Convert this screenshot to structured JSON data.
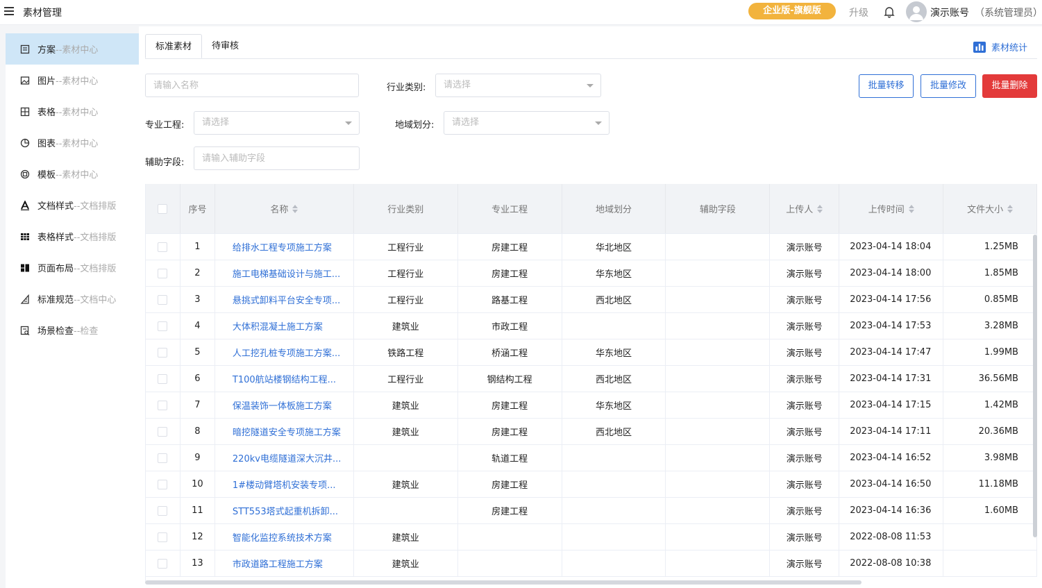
{
  "header": {
    "title": "素材管理",
    "plan_badge": "企业版-旗舰版",
    "upgrade": "升级",
    "user_name": "演示账号",
    "user_role": "（系统管理员）"
  },
  "sidebar": {
    "items": [
      {
        "label": "方案",
        "sub": "--素材中心",
        "icon": "document-icon"
      },
      {
        "label": "图片",
        "sub": "--素材中心",
        "icon": "image-icon"
      },
      {
        "label": "表格",
        "sub": "--素材中心",
        "icon": "table-icon"
      },
      {
        "label": "图表",
        "sub": "--素材中心",
        "icon": "chart-icon"
      },
      {
        "label": "模板",
        "sub": "--素材中心",
        "icon": "template-icon"
      },
      {
        "label": "文档样式",
        "sub": "--文档排版",
        "icon": "font-style-icon"
      },
      {
        "label": "表格样式",
        "sub": "--文档排版",
        "icon": "table-style-icon"
      },
      {
        "label": "页面布局",
        "sub": "--文档排版",
        "icon": "layout-icon"
      },
      {
        "label": "标准规范",
        "sub": "--文档中心",
        "icon": "standard-icon"
      },
      {
        "label": "场景检查",
        "sub": "--检查",
        "icon": "check-icon"
      }
    ]
  },
  "tabs": [
    {
      "label": "标准素材"
    },
    {
      "label": "待审核"
    }
  ],
  "stats_link": "素材统计",
  "filters": {
    "name_placeholder": "请输入名称",
    "industry_label": "行业类别:",
    "industry_placeholder": "请选择",
    "engineering_label": "专业工程:",
    "engineering_placeholder": "请选择",
    "region_label": "地域划分:",
    "region_placeholder": "请选择",
    "aux_label": "辅助字段:",
    "aux_placeholder": "请输入辅助字段"
  },
  "actions": {
    "transfer": "批量转移",
    "modify": "批量修改",
    "delete": "批量删除"
  },
  "table": {
    "headers": [
      "序号",
      "名称",
      "行业类别",
      "专业工程",
      "地域划分",
      "辅助字段",
      "上传人",
      "上传时间",
      "文件大小"
    ],
    "rows": [
      {
        "no": "1",
        "name": "给排水工程专项施工方案",
        "industry": "工程行业",
        "eng": "房建工程",
        "region": "华北地区",
        "aux": "",
        "uploader": "演示账号",
        "time": "2023-04-14 18:04",
        "size": "1.25MB"
      },
      {
        "no": "2",
        "name": "施工电梯基础设计与施工...",
        "industry": "工程行业",
        "eng": "房建工程",
        "region": "华东地区",
        "aux": "",
        "uploader": "演示账号",
        "time": "2023-04-14 18:00",
        "size": "1.85MB"
      },
      {
        "no": "3",
        "name": "悬挑式卸料平台安全专项...",
        "industry": "工程行业",
        "eng": "路基工程",
        "region": "西北地区",
        "aux": "",
        "uploader": "演示账号",
        "time": "2023-04-14 17:56",
        "size": "0.85MB"
      },
      {
        "no": "4",
        "name": "大体积混凝土施工方案",
        "industry": "建筑业",
        "eng": "市政工程",
        "region": "",
        "aux": "",
        "uploader": "演示账号",
        "time": "2023-04-14 17:53",
        "size": "3.28MB"
      },
      {
        "no": "5",
        "name": "人工挖孔桩专项施工方案...",
        "industry": "铁路工程",
        "eng": "桥涵工程",
        "region": "华东地区",
        "aux": "",
        "uploader": "演示账号",
        "time": "2023-04-14 17:47",
        "size": "1.99MB"
      },
      {
        "no": "6",
        "name": "T100航站楼钢结构工程...",
        "industry": "工程行业",
        "eng": "钢结构工程",
        "region": "西北地区",
        "aux": "",
        "uploader": "演示账号",
        "time": "2023-04-14 17:31",
        "size": "36.56MB"
      },
      {
        "no": "7",
        "name": "保温装饰一体板施工方案",
        "industry": "建筑业",
        "eng": "房建工程",
        "region": "华东地区",
        "aux": "",
        "uploader": "演示账号",
        "time": "2023-04-14 17:15",
        "size": "1.42MB"
      },
      {
        "no": "8",
        "name": "暗挖隧道安全专项施工方案",
        "industry": "建筑业",
        "eng": "房建工程",
        "region": "西北地区",
        "aux": "",
        "uploader": "演示账号",
        "time": "2023-04-14 17:11",
        "size": "20.36MB"
      },
      {
        "no": "9",
        "name": "220kv电缆隧道深大沉井...",
        "industry": "",
        "eng": "轨道工程",
        "region": "",
        "aux": "",
        "uploader": "演示账号",
        "time": "2023-04-14 16:52",
        "size": "3.98MB"
      },
      {
        "no": "10",
        "name": "1#楼动臂塔机安装专项...",
        "industry": "建筑业",
        "eng": "房建工程",
        "region": "",
        "aux": "",
        "uploader": "演示账号",
        "time": "2023-04-14 16:50",
        "size": "11.18MB"
      },
      {
        "no": "11",
        "name": "STT553塔式起重机拆卸...",
        "industry": "",
        "eng": "房建工程",
        "region": "",
        "aux": "",
        "uploader": "演示账号",
        "time": "2023-04-14 16:36",
        "size": "1.60MB"
      },
      {
        "no": "12",
        "name": "智能化监控系统技术方案",
        "industry": "建筑业",
        "eng": "",
        "region": "",
        "aux": "",
        "uploader": "演示账号",
        "time": "2022-08-08 11:53",
        "size": ""
      },
      {
        "no": "13",
        "name": "市政道路工程施工方案",
        "industry": "建筑业",
        "eng": "",
        "region": "",
        "aux": "",
        "uploader": "演示账号",
        "time": "2022-08-08 10:38",
        "size": ""
      }
    ]
  },
  "colors": {
    "primary": "#2f6fd6",
    "danger": "#e33a3a",
    "badge": "#f2b33d",
    "active_bg": "#cfe6f7"
  }
}
